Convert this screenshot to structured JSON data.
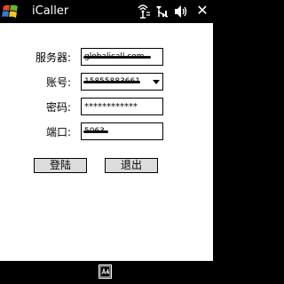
{
  "titlebar": {
    "app_title": "iCaller",
    "close_label": "✕",
    "icons": [
      "start-icon",
      "connectivity-icon",
      "signal-icon",
      "volume-icon"
    ]
  },
  "form": {
    "server": {
      "label": "服务器:",
      "value": "globalicall.com"
    },
    "account": {
      "label": "账号:",
      "value": "15855883661"
    },
    "password": {
      "label": "密码:",
      "value": "************"
    },
    "port": {
      "label": "端口:",
      "value": "5063"
    }
  },
  "buttons": {
    "login_label": "登陆",
    "exit_label": "退出"
  },
  "bottombar": {
    "icon": "keyboard-icon"
  },
  "colors": {
    "bar_background": "#000000",
    "content_background": "#ffffff",
    "button_face": "#dcdcdc"
  }
}
